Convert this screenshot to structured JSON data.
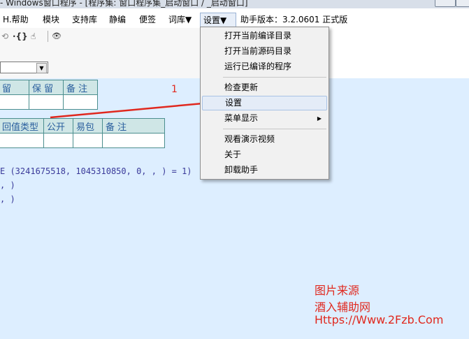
{
  "window": {
    "title": "- Windows窗口程序 - [程序集: 窗口程序集_启动窗口 / _启动窗口]"
  },
  "menubar": {
    "help": "H.帮助",
    "items": [
      "模块",
      "支持库",
      "静编",
      "便签",
      "词库▼",
      "设置▼"
    ],
    "version": "助手版本：3.2.0601 正式版"
  },
  "toolbar": {
    "icons": [
      "undo-icon",
      "braces-icon",
      "hand-icon",
      "binoculars-icon"
    ],
    "glyphs": [
      "⟲",
      "·{}",
      "☝",
      "👁"
    ]
  },
  "table1": {
    "headers": [
      "留",
      "保 留",
      "备 注"
    ]
  },
  "table2": {
    "headers": [
      "回值类型",
      "公开",
      "易包",
      "备 注"
    ]
  },
  "code": {
    "line1": "E (3241675518, 1045310850, 0, , ) = 1)",
    "line2": ", )",
    "line3": ", )"
  },
  "annotation": {
    "number": "1",
    "arrow_color": "#e0281e"
  },
  "dropdown": {
    "items": [
      {
        "label": "打开当前编译目录"
      },
      {
        "label": "打开当前源码目录"
      },
      {
        "label": "运行已编译的程序"
      },
      {
        "label": "检查更新"
      },
      {
        "label": "设置"
      },
      {
        "label": "菜单显示"
      },
      {
        "label": "观看演示视频"
      },
      {
        "label": "关于"
      },
      {
        "label": "卸载助手"
      }
    ],
    "submenu_arrow": "▶"
  },
  "watermark": {
    "line1": "图片来源",
    "line2": "酒入辅助网",
    "line3": "Https://Www.2Fzb.Com"
  }
}
